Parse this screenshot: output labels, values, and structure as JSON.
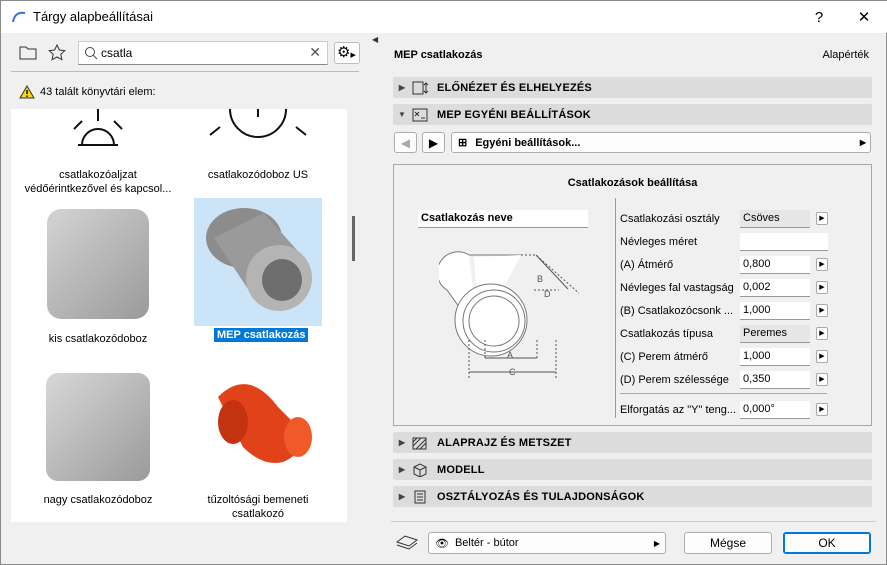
{
  "window": {
    "title": "Tárgy alapbeállításai",
    "help": "?",
    "close": "✕"
  },
  "left": {
    "search_value": "csatla",
    "result_text": "43 talált könyvtári elem:",
    "items": [
      {
        "label": "csatlakozóaljzat védőérintkezővel és kapcsol..."
      },
      {
        "label": "csatlakozódoboz US"
      },
      {
        "label": "kis csatlakozódoboz"
      },
      {
        "label": "MEP csatlakozás"
      },
      {
        "label": "nagy csatlakozódoboz"
      },
      {
        "label": "tűzoltósági bemeneti csatlakozó"
      }
    ]
  },
  "right": {
    "header": "MEP csatlakozás",
    "default_label": "Alapérték",
    "sections": {
      "preview": "ELŐNÉZET ÉS ELHELYEZÉS",
      "custom": "MEP EGYÉNI BEÁLLÍTÁSOK",
      "plan": "ALAPRAJZ ÉS METSZET",
      "model": "MODELL",
      "classification": "OSZTÁLYOZÁS ÉS TULAJDONSÁGOK"
    },
    "page_select": "Egyéni beállítások...",
    "panel": {
      "title": "Csatlakozások beállítása",
      "name_label": "Csatlakozás neve",
      "diagram_labels": {
        "a": "A",
        "b": "B",
        "c": "C",
        "d": "D"
      },
      "rows": [
        {
          "label": "Csatlakozási osztály",
          "value": "Csöves"
        },
        {
          "label": "Névleges méret",
          "value": ""
        },
        {
          "label": "(A) Átmérő",
          "value": "0,800"
        },
        {
          "label": "Névleges fal vastagság",
          "value": "0,002"
        },
        {
          "label": "(B) Csatlakozócsonk ...",
          "value": "1,000"
        },
        {
          "label": "Csatlakozás típusa",
          "value": "Peremes"
        },
        {
          "label": "(C) Perem átmérő",
          "value": "1,000"
        },
        {
          "label": "(D) Perem szélessége",
          "value": "0,350"
        },
        {
          "label": "Elforgatás az \"Y\" teng...",
          "value": "0,000°"
        }
      ]
    }
  },
  "footer": {
    "layer": "Beltér - bútor",
    "cancel": "Mégse",
    "ok": "OK"
  },
  "colors": {
    "selection_bg": "#cce4f7",
    "selection_label": "#0078d7",
    "accent_border": "#0078d7"
  }
}
